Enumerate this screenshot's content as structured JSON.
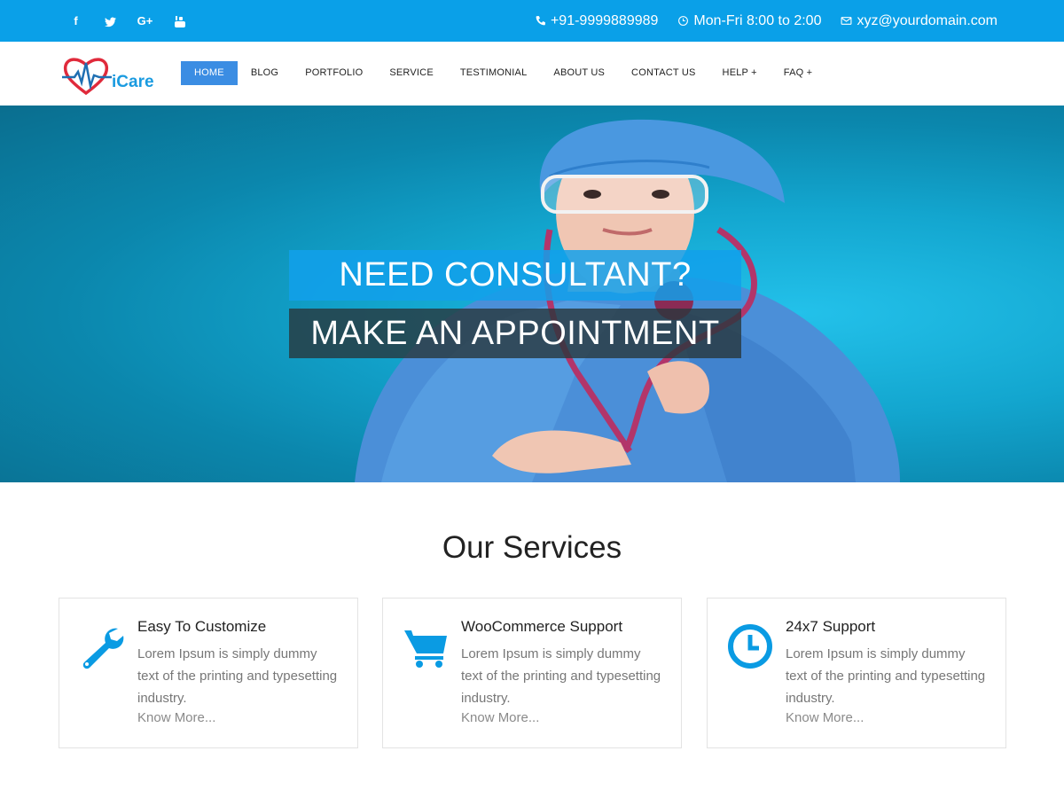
{
  "topbar": {
    "social": [
      "f",
      "t",
      "G+",
      "yt"
    ],
    "phone": "+91-9999889989",
    "hours": "Mon-Fri 8:00 to 2:00",
    "email": "xyz@yourdomain.com"
  },
  "header": {
    "logo_text": "iCare",
    "nav": [
      "HOME",
      "BLOG",
      "PORTFOLIO",
      "SERVICE",
      "TESTIMONIAL",
      "ABOUT US",
      "CONTACT US",
      "HELP +",
      "FAQ +"
    ]
  },
  "hero": {
    "line1": "NEED CONSULTANT?",
    "line2": "MAKE AN APPOINTMENT"
  },
  "services": {
    "title": "Our Services",
    "cards": [
      {
        "title": "Easy To Customize",
        "desc": "Lorem Ipsum is simply dummy text of the printing and typesetting industry.",
        "more": "Know More...",
        "icon": "wrench-icon"
      },
      {
        "title": "WooCommerce Support",
        "desc": "Lorem Ipsum is simply dummy text of the printing and typesetting industry.",
        "more": "Know More...",
        "icon": "cart-icon"
      },
      {
        "title": "24x7 Support",
        "desc": "Lorem Ipsum is simply dummy text of the printing and typesetting industry.",
        "more": "Know More...",
        "icon": "clock-icon"
      }
    ]
  },
  "colors": {
    "accent": "#0aa0e8",
    "nav_active": "#3b8de3"
  }
}
